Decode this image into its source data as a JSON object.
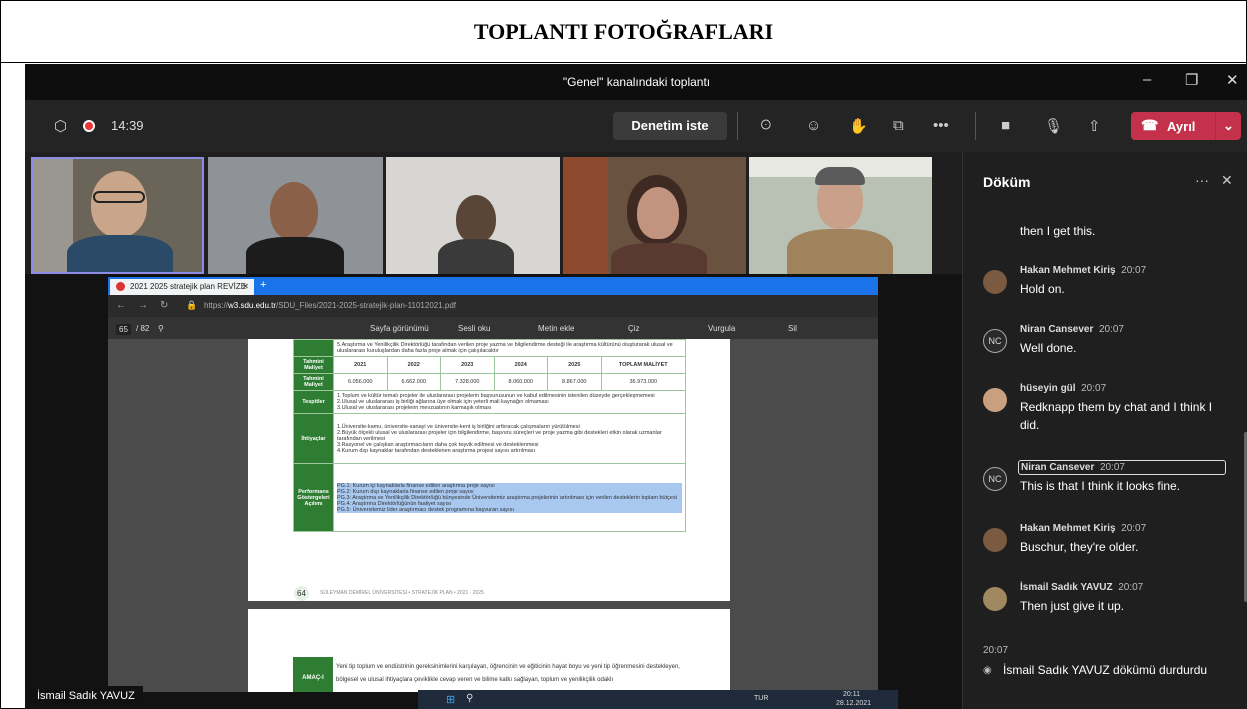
{
  "page": {
    "heading": "TOPLANTI FOTOĞRAFLARI"
  },
  "window": {
    "title": "\"Genel\" kanalındaki toplantı",
    "minimize": "–",
    "maximize": "❐",
    "close": "✕"
  },
  "toolbar": {
    "shield_icon": "⬡",
    "timer": "14:39",
    "help_button": "Denetim iste",
    "people_icon": "ꖴ",
    "chat_icon": "☺",
    "react_icon": "✋",
    "rooms_icon": "⧉",
    "more": "•••",
    "camera_icon": "■",
    "mic_icon": "🎙",
    "share_icon": "⇧",
    "leave_button": "Ayrıl",
    "leave_chevron": "⌄"
  },
  "browser": {
    "tab_title": "2021 2025 stratejik plan REVİZE",
    "tab_close": "✕",
    "new_tab": "+",
    "url_prefix": "https://",
    "url_domain": "w3.sdu.edu.tr",
    "url_path": "/SDU_Files/2021-2025-stratejik-plan-11012021.pdf",
    "page_current": "65",
    "page_total": "/ 82",
    "pdf_tools": [
      "Sayfa görünümü",
      "Sesli oku",
      "Metin ekle",
      "Çiz",
      "Vurgula",
      "Sil"
    ]
  },
  "document": {
    "top_text": "5.Araştırma ve Yenilikçilik Direktörlüğü tarafından verilen proje yazma ve bilgilendirme desteği ile araştırma kültürünü oluşturarak ulusal ve uluslararası kuruluşlardan daha fazla proje almak için çalışılacaktır",
    "row_labels": {
      "cost_header": "Tahmini Maliyet",
      "cost": "Tahmini Maliyet",
      "findings": "Tespitler",
      "needs": "İhtiyaçlar",
      "indicators": "Performans Göstergeleri Açılımı"
    },
    "years": [
      "2021",
      "2022",
      "2023",
      "2024",
      "2025"
    ],
    "total_header": "TOPLAM MALİYET",
    "costs": [
      "6.056.000",
      "6.662.000",
      "7.328.000",
      "8.060.000",
      "8.867.000"
    ],
    "total_cost": "36.973.000",
    "findings": [
      "1.Toplum ve kültür temalı projeler ile uluslararası projelerin başvurusunun ve kabul edilmesinin istenilen düzeyde gerçekleşmemesi",
      "2.Ulusal ve uluslararası iş birliği ağlarına üye olmak için yeterli mali kaynağın olmaması",
      "3.Ulusal ve uluslararası projelerin mevzuatının karmaşık olması"
    ],
    "needs": [
      "1.Üniversite-kamu, üniversite-sanayi ve üniversite-kent iş birliğini arttıracak çalışmaların yürütülmesi",
      "2.Büyük ölçekli ulusal ve uluslararası projeler için bilgilendirme, başvuru süreçleri ve proje yazma gibi destekleri etkin olarak uzmanlar tarafından verilmesi",
      "3.Rasyonel ve çalışkan araştırmacıların daha çok teşvik edilmesi ve desteklenmesi",
      "4.Kurum dışı kaynaklar tarafından desteklenen araştırma projesi sayısı artırılması"
    ],
    "indicators": [
      "PG.1: Kurum içi kaynaklarla finanse edilen araştırma proje sayısı",
      "PG.2: Kurum dışı kaynaklarla finanse edilen proje sayısı",
      "PG.3: Araştırma ve Yenilikçilik Direktörlüğü bünyesinde Üniversitemiz araştırma projelerinin artırılması için verilen desteklerin toplam bütçesi",
      "PG.4: Araştırma Direktörlüğünün faaliyet sayısı",
      "PG.5: Üniversitemiz lider araştırmacı destek programına başvuran sayısı"
    ],
    "page_number": "64",
    "footer": "SÜLEYMAN DEMİREL ÜNİVERSİTESİ • STRATEJİK PLAN • 2021 · 2025",
    "page2_label": "AMAÇ-I",
    "page2_text": "Yeni tip toplum ve endüstrinin gereksinimlerini karşılayan, öğrencinin ve eğiticinin hayat boyu ve yeni tip öğrenmesini destekleyen, bölgesel ve ulusal ihtiyaçlara çeviklikle cevap veren ve bilime katkı sağlayan, toplum ve yenilikçilik odaklı"
  },
  "share_name": "İsmail Sadık YAVUZ",
  "taskbar": {
    "lang": "TUR",
    "time": "20:11",
    "date": "28.12.2021"
  },
  "transcript": {
    "title": "Döküm",
    "more": "···",
    "close": "✕",
    "first_text": "then I get this.",
    "messages": [
      {
        "initials": "",
        "name": "Hakan Mehmet Kiriş",
        "time": "20:07",
        "text": "Hold on."
      },
      {
        "initials": "NC",
        "name": "Niran Cansever",
        "time": "20:07",
        "text": "Well done."
      },
      {
        "initials": "",
        "name": "hüseyin gül",
        "time": "20:07",
        "text": "Redknapp them by chat and I think I did."
      },
      {
        "initials": "NC",
        "name": "Niran Cansever",
        "time": "20:07",
        "text": "This is that I think it looks fine."
      },
      {
        "initials": "",
        "name": "Hakan Mehmet Kiriş",
        "time": "20:07",
        "text": "Buschur, they're older."
      },
      {
        "initials": "",
        "name": "İsmail Sadık YAVUZ",
        "time": "20:07",
        "text": "Then just give it up."
      }
    ],
    "system_time": "20:07",
    "system_text": "İsmail Sadık YAVUZ dökümü durdurdu"
  },
  "colors": {
    "leave": "#c4314b",
    "speaker_border": "#8c8ce6",
    "doc_green": "#2e7d32",
    "highlight": "#a8c8f0"
  }
}
